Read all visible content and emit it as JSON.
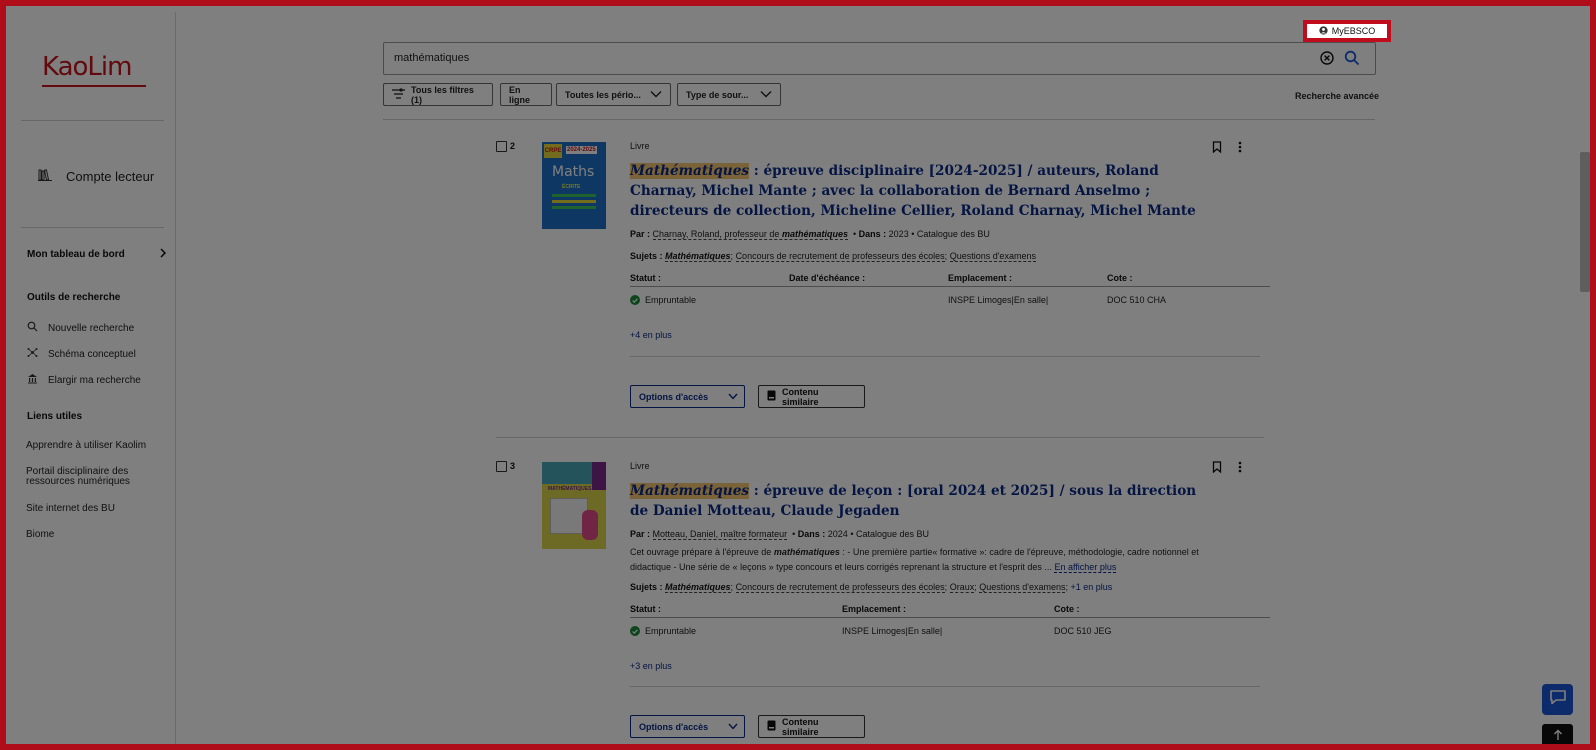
{
  "brand": {
    "logo": "KaoLim",
    "accent": "#c4141c",
    "link_color": "#0a2a86",
    "highlight": "#f5c472",
    "frame": "#b00d1a"
  },
  "sidebar": {
    "account": "Compte lecteur",
    "dashboard": "Mon tableau de bord",
    "tools_title": "Outils de recherche",
    "tools": [
      "Nouvelle recherche",
      "Schéma conceptuel",
      "Elargir ma recherche"
    ],
    "links_title": "Liens utiles",
    "links": [
      "Apprendre à utiliser Kaolim",
      "Portail disciplinaire des ressources numériques",
      "Site internet des BU",
      "Biome"
    ]
  },
  "header": {
    "myebsco": "MyEBSCO",
    "search_value": "mathématiques",
    "filters": [
      "Tous les filtres (1)",
      "En ligne",
      "Toutes les pério...",
      "Type de sour..."
    ],
    "advanced": "Recherche avancée"
  },
  "results": [
    {
      "number": "2",
      "type": "Livre",
      "title_hl": "Mathématiques",
      "title_rest": " : épreuve disciplinaire [2024-2025] / auteurs, Roland Charnay, Michel Mante ; avec la collaboration de Bernard Anselmo ; directeurs de collection, Micheline Cellier, Roland Charnay, Michel Mante",
      "par_label": "Par :",
      "author": "Charnay, Roland, professeur de",
      "author_em": "mathématiques",
      "dans_label": "Dans :",
      "year": "2023",
      "catalog": "Catalogue des BU",
      "subjects_label": "Sujets :",
      "subjects_em": "Mathématiques",
      "subjects": [
        "Concours de recrutement de professeurs des écoles",
        "Questions d'examens"
      ],
      "headers": [
        "Statut :",
        "Date d'échéance :",
        "Emplacement :",
        "Cote :"
      ],
      "status": "Empruntable",
      "location": "INSPE Limoges|En salle|",
      "cote": "DOC 510 CHA",
      "more": "+4 en plus",
      "access": "Options d'accès",
      "similar": "Contenu similaire",
      "cover_badge": "CRPE",
      "cover_year": "2024-2025",
      "cover_title": "Maths",
      "cover_sub": "ÉCRITE",
      "cover_color": "#1c6fc7"
    },
    {
      "number": "3",
      "type": "Livre",
      "title_hl": "Mathématiques",
      "title_rest": " : épreuve de leçon : [oral 2024 et 2025] / sous la direction de Daniel Motteau, Claude Jegaden",
      "par_label": "Par :",
      "author": "Motteau, Daniel, maître formateur",
      "dans_label": "Dans :",
      "year": "2024",
      "catalog": "Catalogue des BU",
      "desc_a": "Cet ouvrage prépare à l'épreuve de",
      "desc_em": "mathématiques",
      "desc_b": ": - Une première partie« formative »: cadre de l'épreuve, méthodologie, cadre notionnel et didactique - Une série de « leçons » type concours et leurs corrigés reprenant la structure et l'esprit des ...",
      "desc_more": "En afficher plus",
      "subjects_label": "Sujets :",
      "subjects_em": "Mathématiques",
      "subjects": [
        "Concours de recrutement de professeurs des écoles",
        "Oraux",
        "Questions d'examens"
      ],
      "subjects_more": "+1 en plus",
      "headers": [
        "Statut :",
        "Emplacement :",
        "Cote :"
      ],
      "status": "Empruntable",
      "location": "INSPE Limoges|En salle|",
      "cote": "DOC 510 JEG",
      "more": "+3 en plus",
      "access": "Options d'accès",
      "similar": "Contenu similaire",
      "cover_title": "MATHÉMATIQUES",
      "cover_color": "#d8d44a"
    }
  ]
}
